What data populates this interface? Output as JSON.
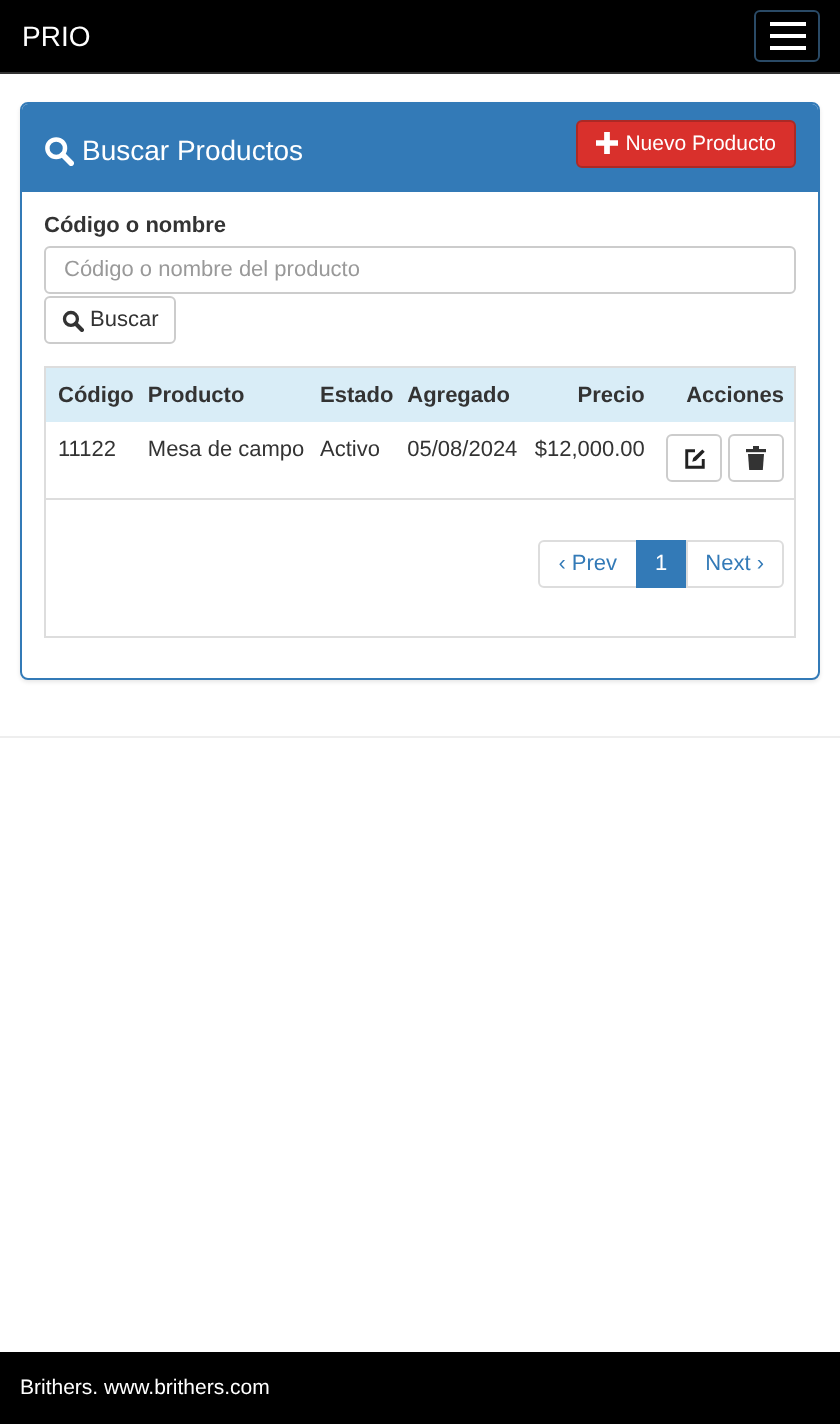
{
  "navbar": {
    "brand": "PRIO"
  },
  "panel": {
    "title": "Buscar Productos",
    "new_button": "Nuevo Producto",
    "search": {
      "label": "Código o nombre",
      "placeholder": "Código o nombre del producto",
      "button": "Buscar"
    },
    "table": {
      "columns": [
        "Código",
        "Producto",
        "Estado",
        "Agregado",
        "Precio",
        "Acciones"
      ],
      "rows": [
        {
          "cells": [
            "11122",
            "Mesa de campo",
            "Activo",
            "05/08/2024",
            "$12,000.00"
          ]
        }
      ]
    },
    "pagination": [
      {
        "label": "‹ Prev",
        "selected": false
      },
      {
        "label": "1",
        "selected": true
      },
      {
        "label": "Next ›",
        "selected": false
      }
    ]
  },
  "footer": "Brithers. www.brithers.com"
}
